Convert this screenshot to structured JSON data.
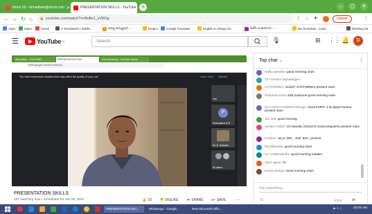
{
  "browser": {
    "tabs": [
      {
        "label": "Inbox (4) - drmadhavi@olcsit.com",
        "favicon_color": "#e74c3c",
        "active": false
      },
      {
        "label": "PRESENTATION SKILLS - YouTube",
        "favicon_color": "#ff0000",
        "active": true
      }
    ],
    "new_tab_symbol": "+",
    "url": "youtube.com/watch?v=8n8e1_vV5Og",
    "update_label": "Update",
    "bookmarks": [
      {
        "label": "Apps",
        "color": "#4285f4"
      },
      {
        "label": "Maps",
        "color": "#34a853"
      },
      {
        "label": "Gmail",
        "color": "#ea4335"
      },
      {
        "label": "S Shadotesh | Siddhi...",
        "color": "#555555"
      },
      {
        "label": "అమ్మ చిమ్ముపురి...",
        "color": "#ff9800"
      },
      {
        "label": "Empire",
        "color": "#fbbc05"
      },
      {
        "label": "Google Translate",
        "color": "#4285f4"
      },
      {
        "label": "English to Telugu Di...",
        "color": "#fbbc05"
      },
      {
        "label": "సీటీసీ (Lakshmi) -...",
        "color": "#9c27b0"
      },
      {
        "label": "My Schedule - Lead...",
        "color": "#fbbc05"
      },
      {
        "label": "Reading list",
        "color": "#555555"
      }
    ]
  },
  "youtube": {
    "logo_text": "YouTube",
    "logo_suffix": "IN",
    "search_placeholder": "Search",
    "avatar_letter": "D"
  },
  "video": {
    "inner_tabs": [
      "New (894) - YOUTHMR",
      "PRESENTATION SKIL",
      "Live streaming - YouTube Studio"
    ],
    "inner_url": "meet.google.com/cts-kwmb-tjx",
    "warning_text": "You have extensions installed that may affect the quality of your call",
    "learn_more": "Learn more",
    "dismiss": "Dismiss",
    "participants": [
      {
        "name": "You",
        "letter": "",
        "bg": "#3c4043"
      },
      {
        "name": "Padmalatha M R",
        "letter": "P",
        "bg": "#5f6368"
      },
      {
        "name": "Mr. B. Harinath",
        "letter": "",
        "bg": "#3c4043"
      },
      {
        "name": "98 others",
        "letter": "",
        "bg": "#3c4043"
      }
    ]
  },
  "meta": {
    "title": "PRESENTATION SKILLS",
    "stats": "227 watching now • Scheduled for Jan 28, 2022",
    "like_count": "10",
    "dislike": "DISLIKE",
    "share": "SHARE",
    "save": "SAVE",
    "more": "..."
  },
  "chat": {
    "header": "Top chat",
    "messages": [
      {
        "author": "Nafia Ipandara",
        "text": "good morning mam",
        "color": "#7e57c2"
      },
      {
        "author": "707 sravani Jayaranigaru",
        "text": "",
        "color": "#26a69a"
      },
      {
        "author": "JYOTHIRMAI",
        "text": "211107 JYOTHIRMAI present mam",
        "color": "#ef6c00"
      },
      {
        "author": "Prasanna Kusa",
        "text": "628 prasanna good morning mam",
        "color": "#8d6e63"
      },
      {
        "author": "212 VIJAYA KUMARI Maruga",
        "text": "211112 MPC 1 M.vijaya Kumari present mam",
        "color": "#5c6bc0"
      },
      {
        "author": "100 600",
        "text": "good morning",
        "color": "#43a047"
      },
      {
        "author": "nandini chittuh",
        "text": "Ch Nandini 210110 b.com(computers) present mam",
        "color": "#ec407a"
      },
      {
        "author": "Kinshan",
        "text": "1st yr ZNC , Roll :823 , present",
        "color": "#8e24aa"
      },
      {
        "author": "628 Bhumika",
        "text": "good morning mam",
        "color": "#1e88e5"
      },
      {
        "author": "211 130Eratandra",
        "text": "good morning madam",
        "color": "#00897b"
      },
      {
        "author": "dad's queen",
        "text": "hi",
        "color": "#f4511e"
      },
      {
        "author": "Deepa Deepa",
        "text": "Good morning mam",
        "color": "#6d4c41"
      }
    ],
    "input_placeholder": "Say something...",
    "char_count": "0/200"
  },
  "taskbar": {
    "apps": [
      {
        "label": "PRESENTATION SKI...",
        "active": true
      },
      {
        "label": "WhatsApp - Google...",
        "active": false
      },
      {
        "label": "New Microsoft Offic...",
        "active": false
      }
    ],
    "time": "10:05 AM"
  },
  "colors": {
    "tab_bar": "#56a93e",
    "youtube_red": "#ff0000",
    "taskbar": "#3a4a7a",
    "meet_bg": "#202124"
  }
}
